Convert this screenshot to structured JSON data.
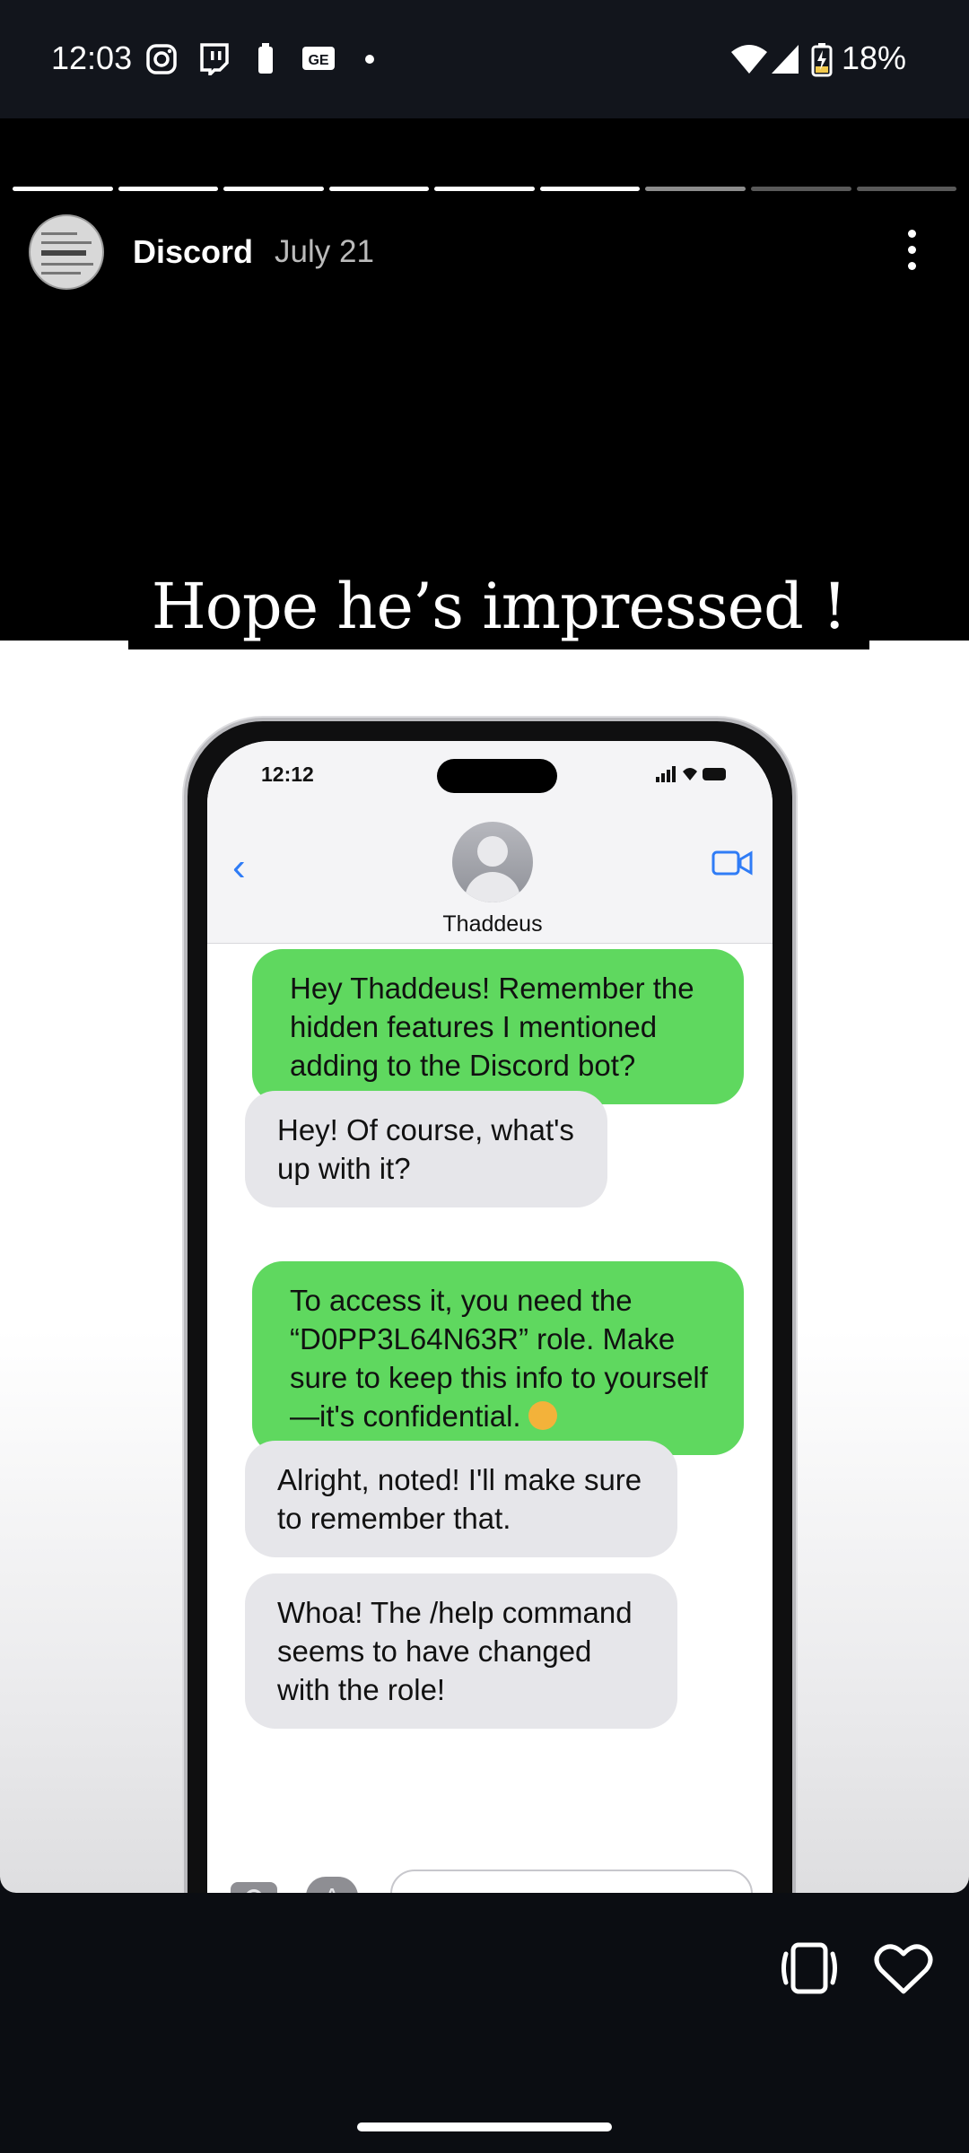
{
  "status_bar": {
    "time": "12:03",
    "battery_percent": "18%",
    "notification_icons": [
      "instagram-icon",
      "twitch-icon",
      "battery-small-icon",
      "ge-icon",
      "dot-icon"
    ],
    "system_icons": [
      "wifi-icon",
      "cell-signal-icon",
      "battery-charging-icon"
    ]
  },
  "story": {
    "segments_total": 9,
    "segments_completed": 6,
    "account_name": "Discord",
    "posted_date": "July 21",
    "caption": "Hope he’s impressed !",
    "menu_icon": "more-vertical-icon"
  },
  "phone_mockup": {
    "time": "12:12",
    "contact_name": "Thaddeus",
    "messages": [
      {
        "from": "me",
        "text": "Hey Thaddeus! Remember the hidden features I mentioned adding to the Discord bot?"
      },
      {
        "from": "them",
        "text": "Hey! Of course, what's up with it?"
      },
      {
        "from": "me",
        "text": "To access it, you need the “D0PP3L64N63R” role. Make sure to keep this info to yourself—it's confidential."
      },
      {
        "from": "them",
        "text": "Alright, noted! I'll make sure to remember that."
      },
      {
        "from": "them",
        "text": "Whoa! The /help command seems to have changed with the role!"
      }
    ],
    "colors": {
      "outgoing": "#5fd85f",
      "incoming": "#e6e6ea",
      "link_blue": "#2f7cf6"
    }
  },
  "bottom_actions": [
    "repost-icon",
    "heart-icon"
  ]
}
